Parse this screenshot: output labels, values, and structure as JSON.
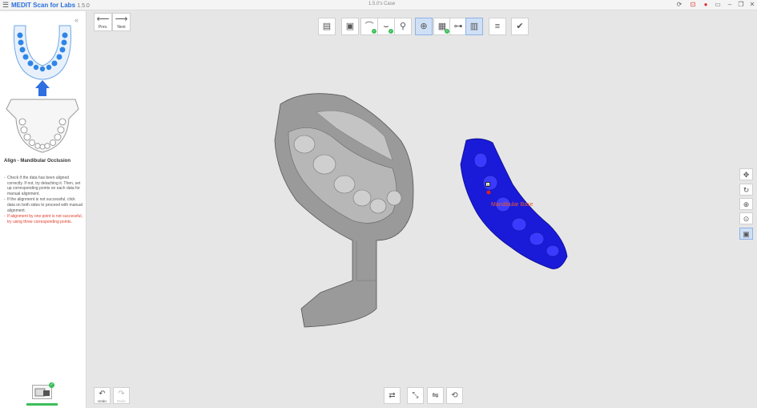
{
  "titlebar": {
    "menu_icon": "hamburger-icon",
    "app_name": "MEDIT Scan for Labs",
    "version": "1.5.0",
    "case_name": "1.5.0's Case",
    "controls": [
      "refresh-icon",
      "screen-capture-icon",
      "record-icon",
      "screenshot-icon",
      "minimize-icon",
      "restore-icon",
      "close-icon"
    ]
  },
  "nav": {
    "prev": "Prev.",
    "next": "Next"
  },
  "sidebar": {
    "collapse": "«",
    "title": "Align - Mandibular Occlusion",
    "instructions": [
      "Check if the data has been aligned correctly. If not, try detaching it. Then, set up corresponding points on each data for manual alignment.",
      "If the alignment is not successful, click data on both sides to proceed with manual alignment."
    ],
    "warning": "If alignment by one point is not successful, try using three corresponding points.",
    "thumb_check": "✓"
  },
  "toolbar": [
    {
      "name": "case-info-tool",
      "glyph": "▤",
      "active": false,
      "check": false
    },
    {
      "name": "scan-box-tool",
      "glyph": "▣",
      "active": false,
      "check": false
    },
    {
      "name": "maxilla-tool",
      "glyph": "⌒",
      "active": false,
      "check": true
    },
    {
      "name": "mandible-tool",
      "glyph": "⌣",
      "active": false,
      "check": true
    },
    {
      "name": "occlusion-tool",
      "glyph": "⚲",
      "active": false,
      "check": false
    },
    {
      "name": "align-tool",
      "glyph": "⊕",
      "active": true,
      "check": false
    },
    {
      "name": "align-maxilla-tool",
      "glyph": "▦",
      "active": false,
      "check": true
    },
    {
      "name": "align-occlusion-tool",
      "glyph": "⊶",
      "active": false,
      "check": false
    },
    {
      "name": "align-mandible-tool",
      "glyph": "▥",
      "active": true,
      "check": false
    },
    {
      "name": "edit-tool",
      "glyph": "≡",
      "active": false,
      "check": false
    },
    {
      "name": "complete-tool",
      "glyph": "✔",
      "active": false,
      "check": false
    }
  ],
  "view_tools": [
    {
      "name": "pan-icon",
      "glyph": "✥",
      "active": false
    },
    {
      "name": "rotate-icon",
      "glyph": "↻",
      "active": false
    },
    {
      "name": "zoom-in-icon",
      "glyph": "⊕",
      "active": false
    },
    {
      "name": "zoom-fit-icon",
      "glyph": "⊙",
      "active": false
    },
    {
      "name": "view-mode-icon",
      "glyph": "▣",
      "active": true
    }
  ],
  "bottom": {
    "undo": "Undo",
    "redo": "Redo",
    "tools": [
      {
        "name": "detach-tool",
        "glyph": "⇄"
      },
      {
        "name": "one-point-align-tool",
        "glyph": "⤡"
      },
      {
        "name": "multi-point-align-tool",
        "glyph": "⇋"
      },
      {
        "name": "reset-tool",
        "glyph": "⟲"
      }
    ]
  },
  "canvas": {
    "model_label": "Mandibular Base",
    "point_number": "1",
    "colors": {
      "gray_model": "#8c8c8c",
      "blue_model": "#1a1ad9",
      "label": "#f05a28"
    }
  }
}
